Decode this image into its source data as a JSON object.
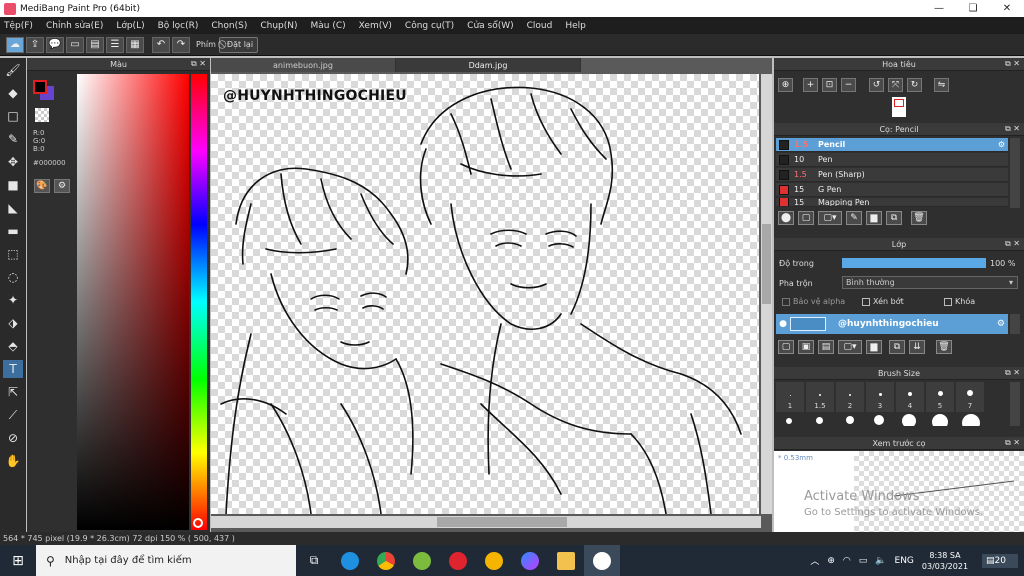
{
  "window": {
    "title": "MediBang Paint Pro (64bit)",
    "controls": [
      "—",
      "❏",
      "✕"
    ]
  },
  "menu": [
    "Tệp(F)",
    "Chỉnh sửa(E)",
    "Lớp(L)",
    "Bộ lọc(R)",
    "Chọn(S)",
    "Chụp(N)",
    "Màu (C)",
    "Xem(V)",
    "Công cụ(T)",
    "Cửa sổ(W)",
    "Cloud",
    "Help"
  ],
  "toolbar": {
    "shortcut_label": "Phím",
    "reset_label": "Đặt lại"
  },
  "color_panel": {
    "title": "Màu",
    "r": "R:0",
    "g": "G:0",
    "b": "B:0",
    "hex": "#000000",
    "fg_color": "#000000",
    "bg_color": "#6644cc"
  },
  "tabs": [
    "animebuon.jpg",
    "Ddam.jpg"
  ],
  "canvas": {
    "watermark": "@HUYNHTHINGOCHIEU"
  },
  "navigator": {
    "title": "Hoa tiêu"
  },
  "brush_panel": {
    "title": "Cọ: Pencil",
    "brushes": [
      {
        "size": "1.5",
        "name": "Pencil",
        "selected": true,
        "color": "#222222",
        "size_red": true
      },
      {
        "size": "10",
        "name": "Pen",
        "selected": false,
        "color": "#222222",
        "size_red": false
      },
      {
        "size": "1.5",
        "name": "Pen (Sharp)",
        "selected": false,
        "color": "#222222",
        "size_red": true
      },
      {
        "size": "15",
        "name": "G Pen",
        "selected": false,
        "color": "#e03030",
        "size_red": false
      },
      {
        "size": "15",
        "name": "Mapping Pen",
        "selected": false,
        "color": "#e03030",
        "size_red": false
      }
    ]
  },
  "layer_panel": {
    "title": "Lớp",
    "opacity_label": "Độ trong",
    "opacity_value": "100 %",
    "opacity_fraction": 1.0,
    "blend_label": "Pha trộn",
    "blend_value": "Bình thường",
    "protect_alpha": "Bảo vệ alpha",
    "clipping": "Xén bớt",
    "lock": "Khóa",
    "layer_name": "@huynhthingochieu"
  },
  "brush_size": {
    "title": "Brush Size",
    "sizes": [
      "1",
      "1.5",
      "2",
      "3",
      "4",
      "5",
      "7"
    ]
  },
  "brush_preview": {
    "title": "Xem trước cọ",
    "size": "* 0.53mm"
  },
  "activation": {
    "line1": "Activate Windows",
    "line2": "Go to Settings to activate Windows."
  },
  "status": {
    "text": "564 * 745 pixel   (19.9 * 26.3cm)   72 dpi   150 %   ( 500, 437 )"
  },
  "taskbar": {
    "search_placeholder": "Nhập tại đây để tìm kiếm",
    "lang": "ENG",
    "time": "8:38 SA",
    "date": "03/03/2021",
    "notif": "20"
  }
}
